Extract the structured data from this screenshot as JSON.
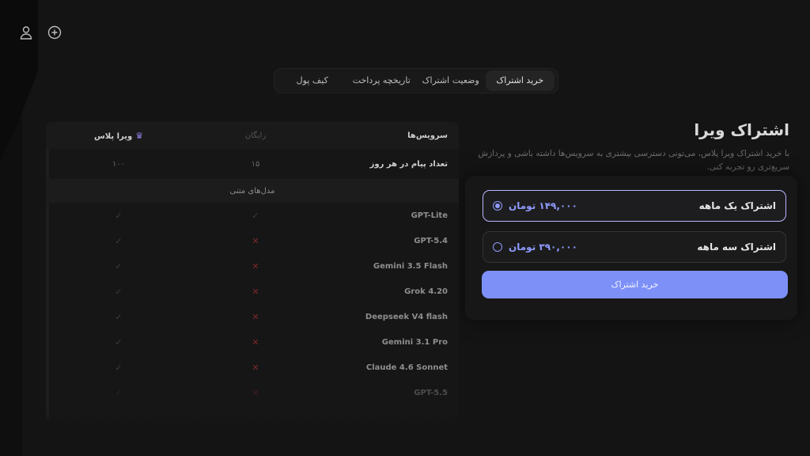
{
  "tabs": [
    {
      "label": "خرید اشتراک",
      "active": true
    },
    {
      "label": "وضعیت اشتراک",
      "active": false
    },
    {
      "label": "تاریخچه پرداخت",
      "active": false
    },
    {
      "label": "کیف پول",
      "active": false
    }
  ],
  "page": {
    "title": "اشتراک ویرا",
    "description": "با خرید اشتراک ویرا پلاس، می‌تونی دسترسی بیشتری به سرویس‌ها داشته باشی و پردازش سریع‌تری رو تجربه کنی."
  },
  "plans": [
    {
      "name": "اشتراک یک ماهه",
      "price": "۱۴۹,۰۰۰ تومان",
      "selected": true
    },
    {
      "name": "اشتراک سه ماهه",
      "price": "۳۹۰,۰۰۰ تومان",
      "selected": false
    }
  ],
  "buy_button": "خرید اشتراک",
  "table": {
    "headers": {
      "service": "سرویس‌ها",
      "free": "رایگان",
      "plus": "ویرا پلاس"
    },
    "messages_row": {
      "label": "تعداد پیام در هر روز",
      "free": "۱۵",
      "plus": "۱۰۰"
    },
    "section": "مدل‌های متنی",
    "models": [
      {
        "name": "GPT-Lite",
        "free": "✓",
        "plus": "✓"
      },
      {
        "name": "GPT-5.4",
        "free": "✕",
        "plus": "✓"
      },
      {
        "name": "Gemini 3.5 Flash",
        "free": "✕",
        "plus": "✓"
      },
      {
        "name": "Grok 4.20",
        "free": "✕",
        "plus": "✓"
      },
      {
        "name": "Deepseek V4 flash",
        "free": "✕",
        "plus": "✓"
      },
      {
        "name": "Gemini 3.1 Pro",
        "free": "✕",
        "plus": "✓"
      },
      {
        "name": "Claude 4.6 Sonnet",
        "free": "✕",
        "plus": "✓"
      },
      {
        "name": "GPT-5.5",
        "free": "✕",
        "plus": "✓"
      }
    ]
  },
  "icons": {
    "new_chat": "plus-circle-icon",
    "user": "user-icon",
    "crown": "crown-icon"
  },
  "colors": {
    "accent": "#7d90f7",
    "price": "#8f9bff",
    "no": "#7b2a2a"
  }
}
